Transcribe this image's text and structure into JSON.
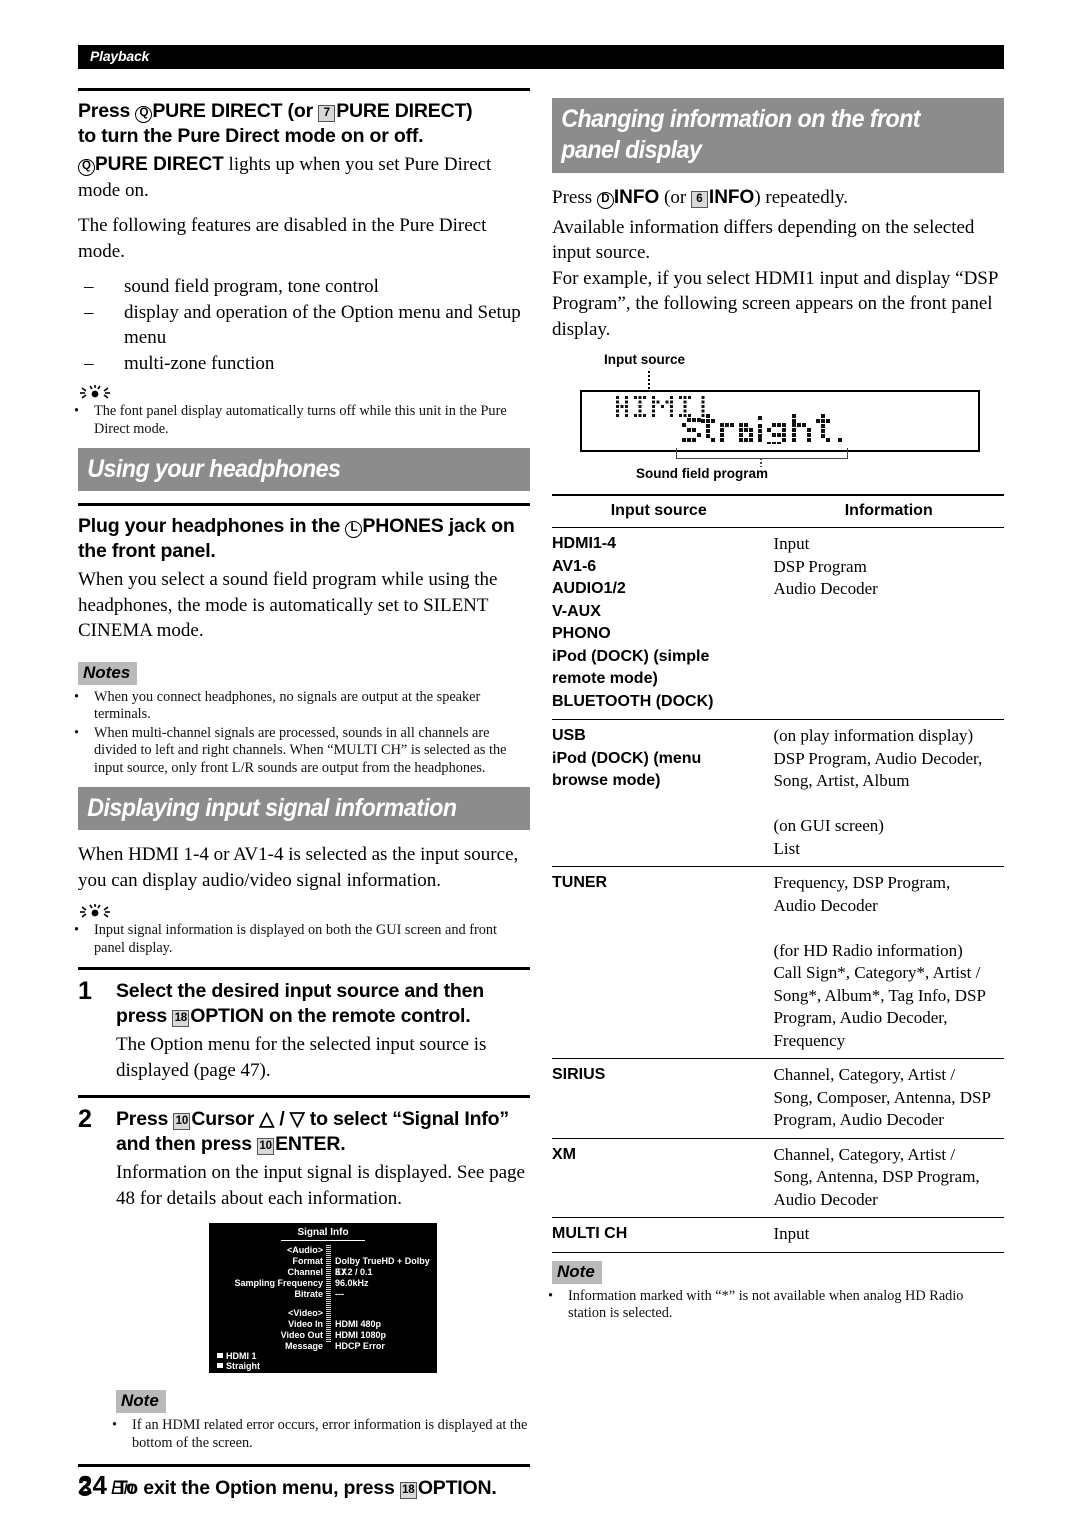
{
  "running_head": {
    "label": "Playback"
  },
  "footer": {
    "page_number": "24",
    "language": "En"
  },
  "left_column": {
    "pure_direct": {
      "heading_line1_pre": "Press ",
      "heading_marker1": "Q",
      "heading_line1_key1": "PURE DIRECT",
      "heading_line1_mid": " (or ",
      "heading_marker2": "7",
      "heading_line1_key2": "PURE DIRECT",
      "heading_line1_post": ")",
      "heading_line2": "to turn the Pure Direct mode on or off.",
      "body_marker": "Q",
      "body_key": "PURE DIRECT",
      "body_text": " lights up when you set Pure Direct mode on.",
      "paragraph2": "The following features are disabled in the Pure Direct mode.",
      "disabled_items": [
        "sound field program, tone control",
        "display and operation of the Option menu and Setup menu",
        "multi-zone function"
      ],
      "tip_bullets": [
        "The font panel display automatically turns off while this unit in the Pure Direct mode."
      ]
    },
    "headphones_section": {
      "bar_title": "Using your headphones",
      "heading_pre": "Plug your headphones in the ",
      "heading_marker": "L",
      "heading_key": "PHONES",
      "heading_post": " jack on the front panel.",
      "body": "When you select a sound field program while using the headphones, the mode is automatically set to SILENT CINEMA mode.",
      "notes_label": "Notes",
      "notes": [
        "When you connect headphones, no signals are output at the speaker terminals.",
        "When multi-channel signals are processed, sounds in all channels are divided to left and right channels. When “MULTI CH” is selected as the input source, only front L/R sounds are output from the headphones."
      ]
    },
    "signal_info_section": {
      "bar_title": "Displaying input signal information",
      "intro": "When HDMI 1-4 or AV1-4 is selected as the input source, you can display audio/video signal information.",
      "tip_bullets": [
        "Input signal information is displayed on both the GUI screen and front panel display."
      ],
      "steps": [
        {
          "number": "1",
          "heading_pre": "Select the desired input source and then press ",
          "heading_marker": "18",
          "heading_key": "OPTION",
          "heading_post": " on the remote control.",
          "body": "The Option menu for the selected input source is displayed (page 47)."
        },
        {
          "number": "2",
          "heading_pre": "Press ",
          "heading_marker": "10",
          "heading_key": "Cursor",
          "heading_mid": " △ / ▽ to select “Signal Info” and then press ",
          "heading_marker2": "10",
          "heading_key2": "ENTER",
          "heading_post": ".",
          "body": "Information on the input signal is displayed. See page 48 for details about each information."
        },
        {
          "number": "3",
          "heading_pre": "To exit the Option menu, press ",
          "heading_marker": "18",
          "heading_key": "OPTION",
          "heading_post": "."
        }
      ],
      "gui_screen": {
        "title": "Signal Info",
        "audio_label": "<Audio>",
        "video_label": "<Video>",
        "rows": [
          {
            "label": "Format",
            "value": "Dolby TrueHD + Dolby EX"
          },
          {
            "label": "Channel",
            "value": "3 / 2 / 0.1"
          },
          {
            "label": "Sampling Frequency",
            "value": "96.0kHz"
          },
          {
            "label": "Bitrate",
            "value": "---"
          },
          {
            "label": "Video In",
            "value": "HDMI  480p"
          },
          {
            "label": "Video Out",
            "value": "HDMI  1080p"
          },
          {
            "label": "Message",
            "value": "HDCP Error"
          }
        ],
        "status_input": "HDMI 1",
        "status_program": "Straight"
      },
      "note_label": "Note",
      "notes": [
        "If an HDMI related error occurs, error information is displayed at the bottom of the screen."
      ]
    }
  },
  "right_column": {
    "bar_title_line1": "Changing information on the front",
    "bar_title_line2": "panel display",
    "intro_pre": "Press ",
    "intro_marker1": "D",
    "intro_key1": "INFO",
    "intro_mid": " (or ",
    "intro_marker2": "6",
    "intro_key2": "INFO",
    "intro_post": ") repeatedly.",
    "intro_body": "Available information differs depending on the selected input source.\nFor example, if you select HDMI1 input and display “DSP Program”, the following screen appears on the front panel display.",
    "front_panel": {
      "callout_top": "Input source",
      "callout_bottom": "Sound field program",
      "input_source_text": "HDMI1",
      "program_text": "Straight"
    },
    "table": {
      "headers": [
        "Input source",
        "Information"
      ],
      "rows": [
        {
          "sources": [
            "HDMI1-4",
            "AV1-6",
            "AUDIO1/2",
            "V-AUX",
            "PHONO",
            "iPod (DOCK) (simple",
            "remote mode)",
            "BLUETOOTH (DOCK)"
          ],
          "information": [
            "Input",
            "DSP Program",
            "Audio Decoder"
          ]
        },
        {
          "sources": [
            "USB",
            "iPod (DOCK) (menu",
            "browse mode)"
          ],
          "information": [
            "(on play information display)",
            "DSP Program, Audio Decoder,",
            "Song, Artist, Album",
            "",
            "(on GUI screen)",
            "List"
          ]
        },
        {
          "sources": [
            "TUNER"
          ],
          "information": [
            "Frequency, DSP Program,",
            "Audio Decoder",
            "",
            "(for HD Radio information)",
            "Call Sign*, Category*, Artist /",
            "Song*, Album*, Tag Info, DSP",
            "Program, Audio Decoder,",
            "Frequency"
          ]
        },
        {
          "sources": [
            "SIRIUS"
          ],
          "information": [
            "Channel, Category, Artist /",
            "Song, Composer, Antenna, DSP",
            "Program, Audio Decoder"
          ]
        },
        {
          "sources": [
            "XM"
          ],
          "information": [
            "Channel, Category, Artist /",
            "Song, Antenna, DSP Program,",
            "Audio Decoder"
          ]
        },
        {
          "sources": [
            "MULTI CH"
          ],
          "information": [
            "Input"
          ]
        }
      ]
    },
    "note_label": "Note",
    "notes": [
      "Information marked with “*” is not available when analog HD Radio station is selected."
    ]
  }
}
